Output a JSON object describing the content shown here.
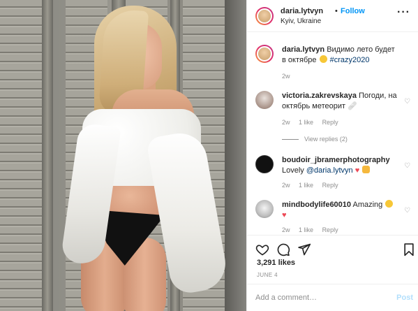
{
  "header": {
    "username": "daria.lytvyn",
    "dot": "•",
    "follow_label": "Follow",
    "location": "Kyiv, Ukraine"
  },
  "caption": {
    "username": "daria.lytvyn",
    "text": "Видимо лето будет в октябре",
    "hashtag": "#crazy2020",
    "age": "2w"
  },
  "comments": [
    {
      "username": "victoria.zakrevskaya",
      "text": "Погоди, на октябрь метеорит",
      "age": "2w",
      "likes": "1 like",
      "reply": "Reply"
    },
    {
      "username": "boudoir_jbramerphotography",
      "text": "Lovely",
      "mention": "@daria.lytvyn",
      "age": "2w",
      "likes": "1 like",
      "reply": "Reply"
    },
    {
      "username": "mindbodylife60010",
      "text": "Amazing",
      "age": "2w",
      "likes": "1 like",
      "reply": "Reply"
    }
  ],
  "view_replies": "View replies (2)",
  "actions": {
    "likes": "3,291 likes",
    "date": "JUNE 4"
  },
  "add_comment": {
    "placeholder": "Add a comment…",
    "post_label": "Post"
  },
  "colors": {
    "accent": "#0095f6",
    "post_disabled": "#b2dffc",
    "muted": "#8e8e8e",
    "text": "#262626"
  }
}
